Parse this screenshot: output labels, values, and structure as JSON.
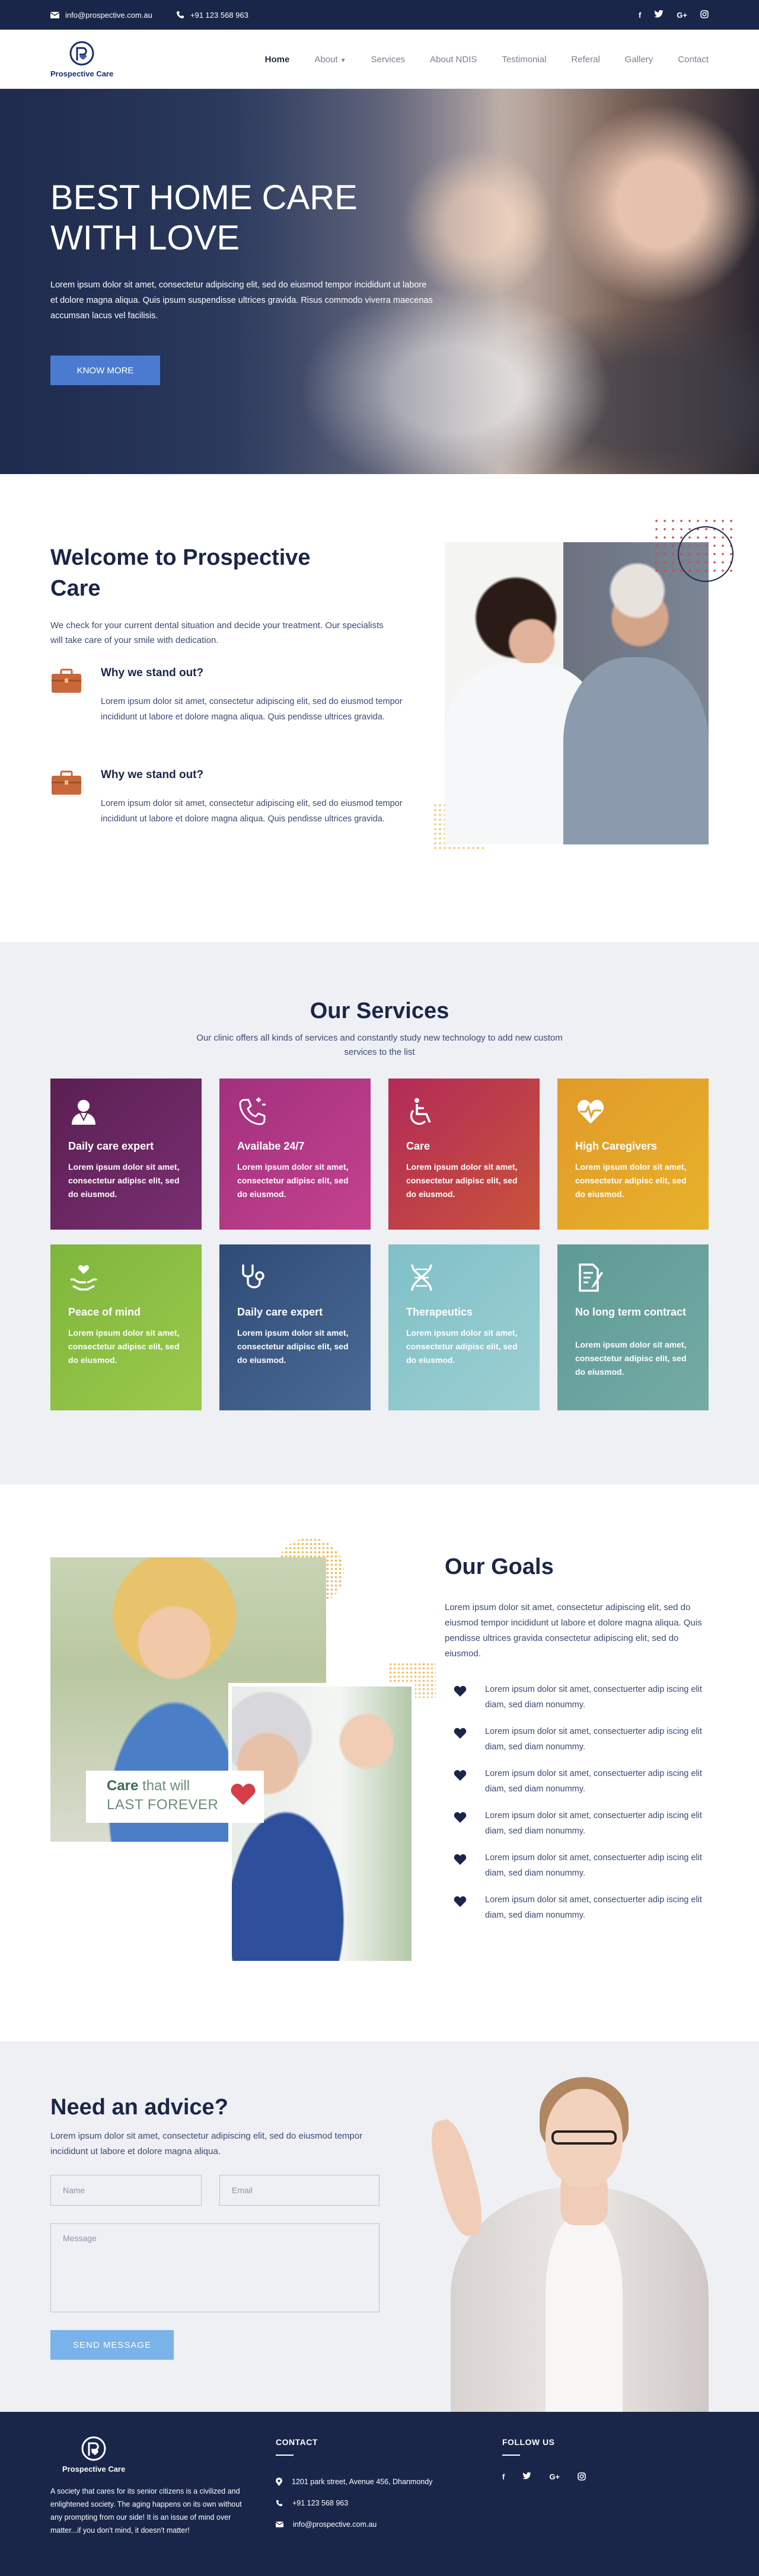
{
  "topbar": {
    "email": "info@prospective.com.au",
    "phone": "+91 123 568 963",
    "social": [
      "f",
      "t",
      "G+",
      "ig"
    ]
  },
  "brand": {
    "name": "Prospective Care"
  },
  "nav": {
    "items": [
      "Home",
      "About",
      "Services",
      "About NDIS",
      "Testimonial",
      "Referal",
      "Gallery",
      "Contact"
    ],
    "active": "Home"
  },
  "hero": {
    "title": "BEST HOME CARE WITH LOVE",
    "text": "Lorem ipsum dolor sit amet, consectetur adipiscing elit, sed do eiusmod tempor incididunt ut labore et dolore magna aliqua. Quis ipsum suspendisse ultrices gravida. Risus commodo viverra maecenas accumsan lacus vel facilisis.",
    "button": "KNOW MORE"
  },
  "welcome": {
    "title": "Welcome to Prospective Care",
    "intro": "We check for your current dental situation and decide your treatment. Our specialists will take care of your smile with dedication.",
    "features": [
      {
        "title": "Why we stand out?",
        "text": "Lorem ipsum dolor sit amet, consectetur adipiscing elit, sed do eiusmod tempor incididunt ut labore et dolore magna aliqua. Quis pendisse ultrices gravida."
      },
      {
        "title": "Why we stand out?",
        "text": "Lorem ipsum dolor sit amet, consectetur adipiscing elit, sed do eiusmod tempor incididunt ut labore et dolore magna aliqua. Quis pendisse ultrices gravida."
      }
    ]
  },
  "services": {
    "title": "Our Services",
    "subtitle": "Our clinic offers all kinds of services and constantly study new technology to add new custom services to the list",
    "cards": [
      {
        "title": "Daily care expert",
        "text": "Lorem ipsum dolor sit amet, consectetur adipisc elit, sed do eiusmod.",
        "icon": "user-icon",
        "color_from": "#5a1f52",
        "color_to": "#7a2f72"
      },
      {
        "title": "Availabe 24/7",
        "text": "Lorem ipsum dolor sit amet, consectetur adipisc elit, sed do eiusmod.",
        "icon": "phone-icon",
        "color_from": "#a2307e",
        "color_to": "#c4428e"
      },
      {
        "title": "Care",
        "text": "Lorem ipsum dolor sit amet, consectetur adipisc elit, sed do eiusmod.",
        "icon": "wheelchair-icon",
        "color_from": "#b32a58",
        "color_to": "#c8543a"
      },
      {
        "title": "High Caregivers",
        "text": "Lorem ipsum dolor sit amet, consectetur adipisc elit, sed do eiusmod.",
        "icon": "heart-pulse-icon",
        "color_from": "#e19a2a",
        "color_to": "#e7b22a"
      },
      {
        "title": "Peace of mind",
        "text": "Lorem ipsum dolor sit amet, consectetur adipisc elit, sed do eiusmod.",
        "icon": "hands-icon",
        "color_from": "#7eb63c",
        "color_to": "#9bc94c"
      },
      {
        "title": "Daily care expert",
        "text": "Lorem ipsum dolor sit amet, consectetur adipisc elit, sed do eiusmod.",
        "icon": "stethoscope-icon",
        "color_from": "#2f4a76",
        "color_to": "#4a6c96"
      },
      {
        "title": "Therapeutics",
        "text": "Lorem ipsum dolor sit amet, consectetur adipisc elit, sed do eiusmod.",
        "icon": "dna-icon",
        "color_from": "#7fc0c7",
        "color_to": "#9ccfd2"
      },
      {
        "title": "No long term contract",
        "text": "Lorem ipsum dolor sit amet, consectetur adipisc elit, sed do eiusmod.",
        "icon": "document-icon",
        "color_from": "#5e9a96",
        "color_to": "#74aba4"
      }
    ]
  },
  "goals": {
    "title": "Our Goals",
    "intro": "Lorem ipsum dolor sit amet, consectetur adipiscing elit, sed do eiusmod tempor incididunt ut labore et dolore magna aliqua. Quis pendisse ultrices gravida consectetur adipiscing elit, sed do eiusmod.",
    "items": [
      "Lorem ipsum dolor sit amet, consectuerter adip iscing elit diam, sed diam nonummy.",
      "Lorem ipsum dolor sit amet, consectuerter adip iscing elit diam, sed diam nonummy.",
      "Lorem ipsum dolor sit amet, consectuerter adip iscing elit diam, sed diam nonummy.",
      "Lorem ipsum dolor sit amet, consectuerter adip iscing elit diam, sed diam nonummy.",
      "Lorem ipsum dolor sit amet, consectuerter adip iscing elit diam, sed diam nonummy.",
      "Lorem ipsum dolor sit amet, consectuerter adip iscing elit diam, sed diam nonummy."
    ],
    "badge": {
      "care": "Care",
      "that_will": "that will",
      "last_forever": "LAST FOREVER"
    }
  },
  "advice": {
    "title": "Need an advice?",
    "intro": "Lorem ipsum dolor sit amet, consectetur adipiscing elit, sed do eiusmod tempor incididunt ut labore et dolore magna aliqua.",
    "name_placeholder": "Name",
    "email_placeholder": "Email",
    "message_placeholder": "Message",
    "button": "SEND MESSAGE"
  },
  "footer": {
    "about": "A society that cares for its senior citizens is a civilized and enlightened society. The aging happens on its own without any prompting from our side! It is an issue of mind over matter...if you don't mind, it doesn't matter!",
    "contact_title": "CONTACT",
    "address": "1201 park street, Avenue 456, Dhanmondy",
    "phone": "+91 123 568 963",
    "email": "info@prospective.com.au",
    "follow_title": "FOLLOW US",
    "social": [
      "f",
      "t",
      "G+",
      "ig"
    ]
  }
}
